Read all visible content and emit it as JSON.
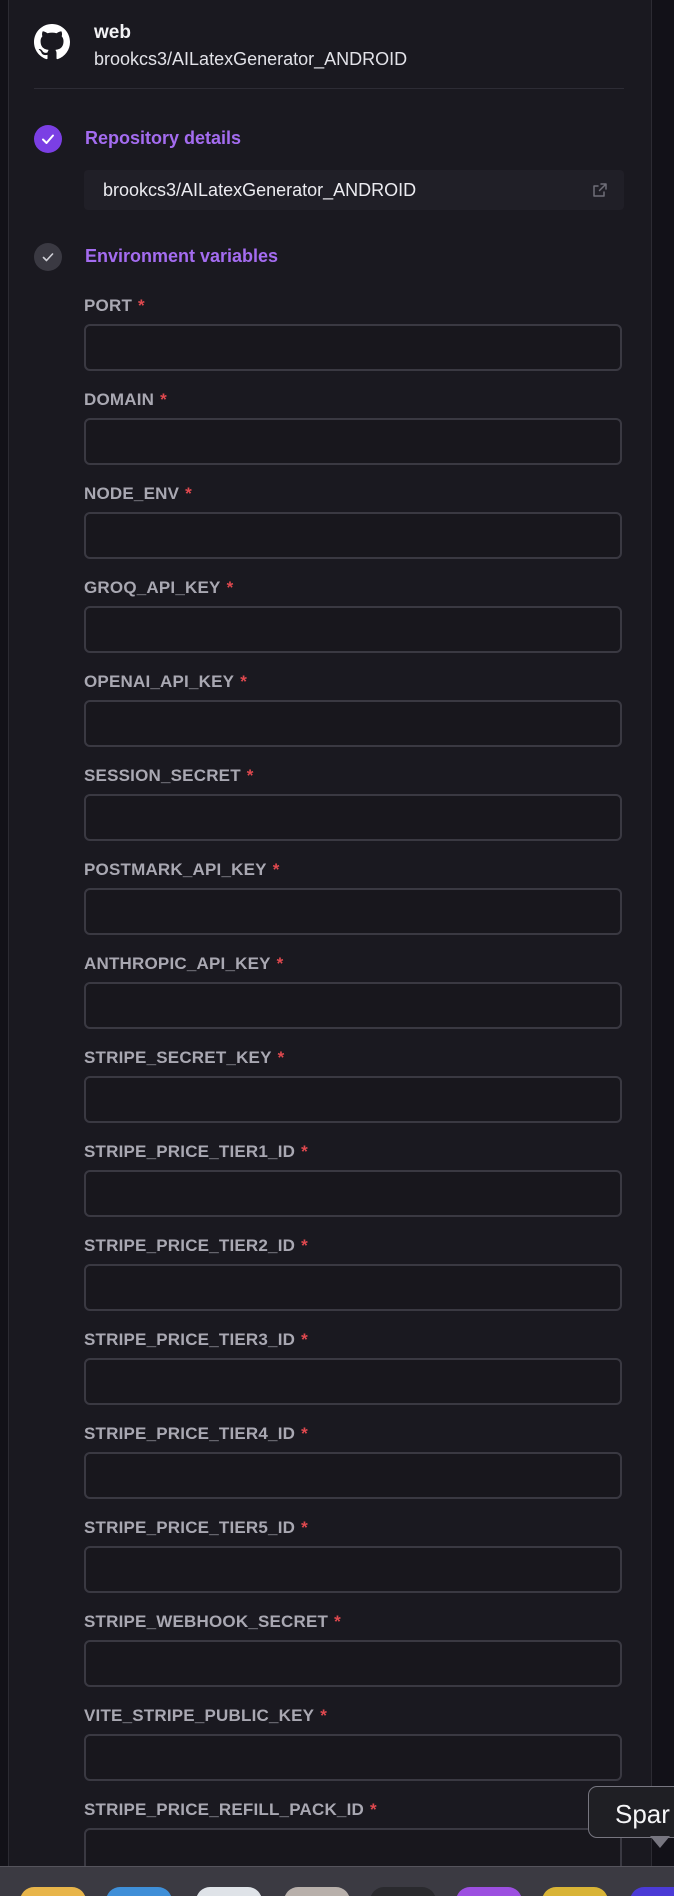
{
  "repo_header": {
    "kind": "web",
    "full_name": "brookcs3/AILatexGenerator_ANDROID"
  },
  "steps": {
    "repository_details": {
      "title": "Repository details",
      "repo": "brookcs3/AILatexGenerator_ANDROID"
    },
    "environment_variables": {
      "title": "Environment variables"
    }
  },
  "required_marker": "*",
  "env_fields": [
    {
      "name": "PORT",
      "value": ""
    },
    {
      "name": "DOMAIN",
      "value": ""
    },
    {
      "name": "NODE_ENV",
      "value": ""
    },
    {
      "name": "GROQ_API_KEY",
      "value": ""
    },
    {
      "name": "OPENAI_API_KEY",
      "value": ""
    },
    {
      "name": "SESSION_SECRET",
      "value": ""
    },
    {
      "name": "POSTMARK_API_KEY",
      "value": ""
    },
    {
      "name": "ANTHROPIC_API_KEY",
      "value": ""
    },
    {
      "name": "STRIPE_SECRET_KEY",
      "value": ""
    },
    {
      "name": "STRIPE_PRICE_TIER1_ID",
      "value": ""
    },
    {
      "name": "STRIPE_PRICE_TIER2_ID",
      "value": ""
    },
    {
      "name": "STRIPE_PRICE_TIER3_ID",
      "value": ""
    },
    {
      "name": "STRIPE_PRICE_TIER4_ID",
      "value": ""
    },
    {
      "name": "STRIPE_PRICE_TIER5_ID",
      "value": ""
    },
    {
      "name": "STRIPE_WEBHOOK_SECRET",
      "value": ""
    },
    {
      "name": "VITE_STRIPE_PUBLIC_KEY",
      "value": ""
    },
    {
      "name": "STRIPE_PRICE_REFILL_PACK_ID",
      "value": ""
    }
  ],
  "tooltip": {
    "text": "Spar"
  },
  "colors": {
    "accent": "#7b3fe4",
    "step_title": "#a46cf0",
    "required": "#e0494f",
    "background": "#1a1920"
  },
  "icons": {
    "repo": "github-icon",
    "step_done": "check-icon",
    "external": "external-link-icon"
  },
  "dock_apps": [
    {
      "name": "dock-app-notes",
      "color": "#e8b54a"
    },
    {
      "name": "dock-app-finder",
      "color": "#3f8fd8"
    },
    {
      "name": "dock-app-safari",
      "color": "#dfe3e8"
    },
    {
      "name": "dock-app-calendar",
      "color": "#b8b0ab"
    },
    {
      "name": "dock-app-terminal",
      "color": "#2a2a2e"
    },
    {
      "name": "dock-app-podcasts",
      "color": "#9c4fe0"
    },
    {
      "name": "dock-app-banana",
      "color": "#d9b436"
    },
    {
      "name": "dock-app-indigo",
      "color": "#4b3bd6"
    }
  ]
}
